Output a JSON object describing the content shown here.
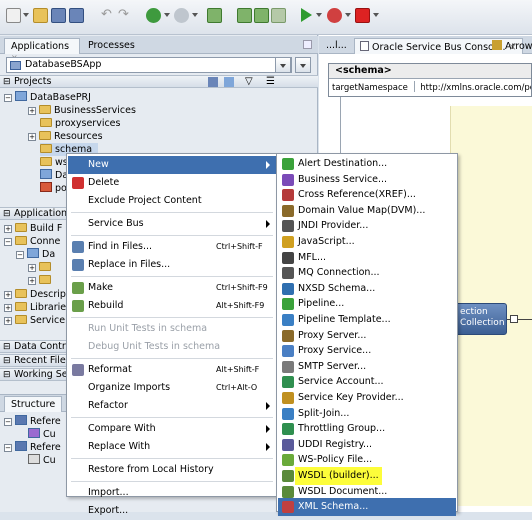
{
  "toolbar": {
    "icons": [
      "new-file-icon",
      "open-folder-icon",
      "save-icon",
      "save-all-icon",
      "undo-icon",
      "redo-icon",
      "back-icon",
      "forward-icon",
      "deploy-icon",
      "build-icon",
      "rebuild-icon",
      "run-icon",
      "debug-icon",
      "stop-icon"
    ]
  },
  "left": {
    "tabs": [
      "Applications",
      "Processes"
    ],
    "app_select": "DatabaseBSApp",
    "projects_header": "Projects",
    "tree": [
      {
        "label": "DataBasePRJ",
        "level": 0
      },
      {
        "label": "BusinessServices",
        "level": 1
      },
      {
        "label": "proxyservices",
        "level": 1
      },
      {
        "label": "Resources",
        "level": 1
      },
      {
        "label": "schema",
        "level": 1
      },
      {
        "label": "ws",
        "level": 1
      },
      {
        "label": "Da",
        "level": 1
      },
      {
        "label": "po",
        "level": 1
      }
    ],
    "sections": [
      "Application",
      "Recent File",
      "Working Se"
    ],
    "app_tree": [
      "Build F",
      "Conne",
      "Da",
      "",
      "",
      "Descrip",
      "Librarie",
      "Service"
    ],
    "data_section": "Data Contr",
    "structure_header": "Structure",
    "structure_tree": [
      "Refere",
      "Cu",
      "Refere",
      "Cu"
    ]
  },
  "editor": {
    "tabs": [
      "...l...",
      "Oracle Service Bus Consol...",
      "Arrow"
    ],
    "schema_title": "<schema>",
    "target_ns_label": "targetNamespace",
    "target_ns_value": "http://xmlns.oracle.com/pcb",
    "proxy_line1": "ection",
    "proxy_line2": "Collection"
  },
  "context_menu": {
    "items": [
      {
        "label": "New",
        "type": "submenu",
        "highlight": true
      },
      {
        "label": "Delete",
        "icon": "delete-icon"
      },
      {
        "label": "Exclude Project Content"
      },
      {
        "sep": true
      },
      {
        "label": "Service Bus",
        "type": "submenu"
      },
      {
        "sep": true
      },
      {
        "label": "Find in Files...",
        "shortcut": "Ctrl+Shift-F",
        "icon": "find-icon"
      },
      {
        "label": "Replace in Files...",
        "icon": "replace-icon"
      },
      {
        "sep": true
      },
      {
        "label": "Make",
        "shortcut": "Ctrl+Shift-F9",
        "icon": "make-icon"
      },
      {
        "label": "Rebuild",
        "shortcut": "Alt+Shift-F9",
        "icon": "rebuild-icon"
      },
      {
        "sep": true
      },
      {
        "label": "Run Unit Tests in schema",
        "disabled": true
      },
      {
        "label": "Debug Unit Tests in schema",
        "disabled": true
      },
      {
        "sep": true
      },
      {
        "label": "Reformat",
        "shortcut": "Alt+Shift-F",
        "icon": "reformat-icon"
      },
      {
        "label": "Organize Imports",
        "shortcut": "Ctrl+Alt-O"
      },
      {
        "label": "Refactor",
        "type": "submenu"
      },
      {
        "sep": true
      },
      {
        "label": "Compare With",
        "type": "submenu"
      },
      {
        "label": "Replace With",
        "type": "submenu"
      },
      {
        "sep": true
      },
      {
        "label": "Restore from Local History"
      },
      {
        "sep": true
      },
      {
        "label": "Import..."
      },
      {
        "label": "Export..."
      }
    ]
  },
  "submenu": {
    "items": [
      {
        "label": "Alert Destination...",
        "icon": "alert-icon",
        "color": "#3aa23a"
      },
      {
        "label": "Business Service...",
        "icon": "business-service-icon",
        "color": "#7b4bb8"
      },
      {
        "label": "Cross Reference(XREF)...",
        "icon": "xref-icon",
        "color": "#b53a3a"
      },
      {
        "label": "Domain Value Map(DVM)...",
        "icon": "dvm-icon",
        "color": "#8a6a2a"
      },
      {
        "label": "JNDI Provider...",
        "icon": "jndi-icon",
        "color": "#555555"
      },
      {
        "label": "JavaScript...",
        "icon": "javascript-icon",
        "color": "#d0a020"
      },
      {
        "label": "MFL...",
        "icon": "mfl-icon",
        "color": "#444444"
      },
      {
        "label": "MQ Connection...",
        "icon": "mq-icon",
        "color": "#555555"
      },
      {
        "label": "NXSD Schema...",
        "icon": "nxsd-icon",
        "color": "#2f6fb0"
      },
      {
        "label": "Pipeline...",
        "icon": "pipeline-icon",
        "color": "#3aa23a"
      },
      {
        "label": "Pipeline Template...",
        "icon": "pipeline-template-icon",
        "color": "#3a7fc4"
      },
      {
        "label": "Proxy Server...",
        "icon": "proxy-server-icon",
        "color": "#8a6a2a"
      },
      {
        "label": "Proxy Service...",
        "icon": "proxy-service-icon",
        "color": "#4a7fc4"
      },
      {
        "label": "SMTP Server...",
        "icon": "smtp-icon",
        "color": "#7a7a7a"
      },
      {
        "label": "Service Account...",
        "icon": "service-account-icon",
        "color": "#2f8f4f"
      },
      {
        "label": "Service Key Provider...",
        "icon": "key-icon",
        "color": "#c09020"
      },
      {
        "label": "Split-Join...",
        "icon": "split-join-icon",
        "color": "#3a7fc4"
      },
      {
        "label": "Throttling Group...",
        "icon": "throttling-icon",
        "color": "#2f8f4f"
      },
      {
        "label": "UDDI Registry...",
        "icon": "uddi-icon",
        "color": "#5a5a9a"
      },
      {
        "label": "WS-Policy File...",
        "icon": "ws-policy-icon",
        "color": "#6aaa3a"
      },
      {
        "label": "WSDL (builder)...",
        "icon": "wsdl-builder-icon",
        "color": "#5a8a3a",
        "yellow": true
      },
      {
        "label": "WSDL Document...",
        "icon": "wsdl-document-icon",
        "color": "#5a8a3a"
      },
      {
        "label": "XML Schema...",
        "icon": "xml-schema-icon",
        "color": "#c04040",
        "partial": true
      }
    ]
  }
}
